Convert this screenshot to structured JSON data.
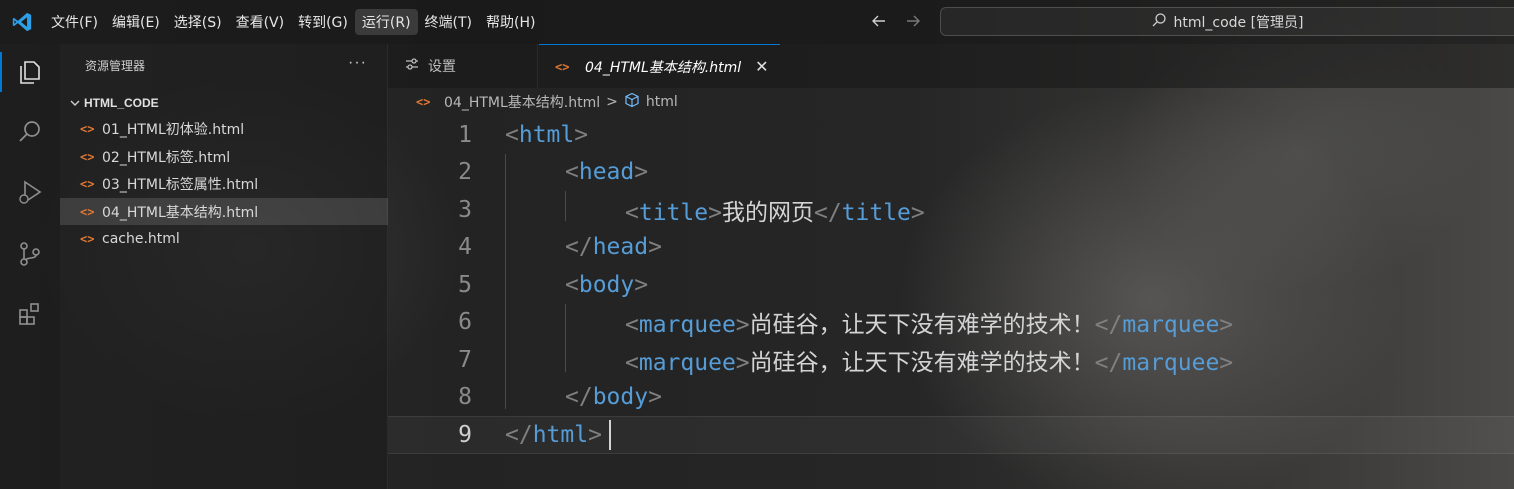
{
  "window": {
    "menu": [
      "文件(F)",
      "编辑(E)",
      "选择(S)",
      "查看(V)",
      "转到(G)",
      "运行(R)",
      "终端(T)",
      "帮助(H)"
    ],
    "active_menu_index": 5,
    "search_text": "html_code [管理员]"
  },
  "sidebar": {
    "title": "资源管理器",
    "more": "···",
    "folder": "HTML_CODE",
    "files": [
      {
        "name": "01_HTML初体验.html",
        "icon": "<>"
      },
      {
        "name": "02_HTML标签.html",
        "icon": "<>"
      },
      {
        "name": "03_HTML标签属性.html",
        "icon": "<>"
      },
      {
        "name": "04_HTML基本结构.html",
        "icon": "<>",
        "selected": true
      },
      {
        "name": "cache.html",
        "icon": "<>"
      }
    ]
  },
  "tabs": [
    {
      "label": "设置",
      "icon": "settings-icon"
    },
    {
      "label": "04_HTML基本结构.html",
      "icon": "<>",
      "active": true
    }
  ],
  "breadcrumb": {
    "file": "04_HTML基本结构.html",
    "separator": ">",
    "symbol": "html"
  },
  "editor": {
    "current_line": 9,
    "lines": [
      {
        "n": "1",
        "tokens": [
          [
            "punct",
            "<"
          ],
          [
            "tag",
            "html"
          ],
          [
            "punct",
            ">"
          ]
        ]
      },
      {
        "n": "2",
        "tokens": [
          [
            "punct",
            "<"
          ],
          [
            "tag",
            "head"
          ],
          [
            "punct",
            ">"
          ]
        ]
      },
      {
        "n": "3",
        "tokens": [
          [
            "punct",
            "<"
          ],
          [
            "tag",
            "title"
          ],
          [
            "punct",
            ">"
          ],
          [
            "text",
            "我的网页"
          ],
          [
            "punct",
            "</"
          ],
          [
            "tag",
            "title"
          ],
          [
            "punct",
            ">"
          ]
        ]
      },
      {
        "n": "4",
        "tokens": [
          [
            "punct",
            "</"
          ],
          [
            "tag",
            "head"
          ],
          [
            "punct",
            ">"
          ]
        ]
      },
      {
        "n": "5",
        "tokens": [
          [
            "punct",
            "<"
          ],
          [
            "tag",
            "body"
          ],
          [
            "punct",
            ">"
          ]
        ]
      },
      {
        "n": "6",
        "tokens": [
          [
            "punct",
            "<"
          ],
          [
            "tag",
            "marquee"
          ],
          [
            "punct",
            ">"
          ],
          [
            "text",
            "尚硅谷，让天下没有难学的技术！"
          ],
          [
            "punct",
            "</"
          ],
          [
            "tag",
            "marquee"
          ],
          [
            "punct",
            ">"
          ]
        ]
      },
      {
        "n": "7",
        "tokens": [
          [
            "punct",
            "<"
          ],
          [
            "tag",
            "marquee"
          ],
          [
            "punct",
            ">"
          ],
          [
            "text",
            "尚硅谷，让天下没有难学的技术！"
          ],
          [
            "punct",
            "</"
          ],
          [
            "tag",
            "marquee"
          ],
          [
            "punct",
            ">"
          ]
        ]
      },
      {
        "n": "8",
        "tokens": [
          [
            "punct",
            "</"
          ],
          [
            "tag",
            "body"
          ],
          [
            "punct",
            ">"
          ]
        ]
      },
      {
        "n": "9",
        "tokens": [
          [
            "punct",
            "</"
          ],
          [
            "tag",
            "html"
          ],
          [
            "punct",
            ">"
          ]
        ]
      }
    ]
  },
  "colors": {
    "accent": "#0078d4",
    "tag": "#569cd6",
    "punct": "#808080",
    "text": "#d4d4d4",
    "html_file_icon": "#e37933"
  }
}
